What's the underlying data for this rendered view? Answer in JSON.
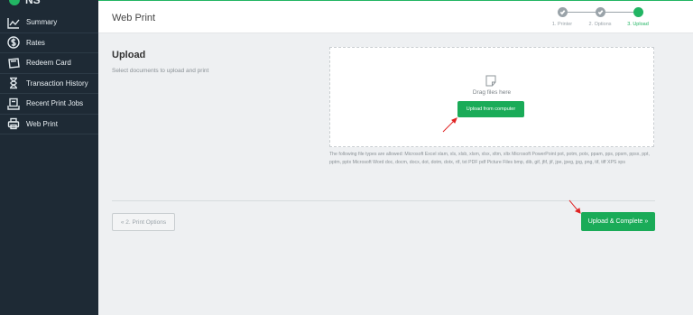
{
  "app": {
    "logo_text": "NS",
    "brand_color": "#22b563"
  },
  "sidebar": {
    "items": [
      {
        "label": "Summary",
        "icon": "chart-line-icon"
      },
      {
        "label": "Rates",
        "icon": "dollar-circle-icon"
      },
      {
        "label": "Redeem Card",
        "icon": "card-icon"
      },
      {
        "label": "Transaction History",
        "icon": "hourglass-icon"
      },
      {
        "label": "Recent Print Jobs",
        "icon": "print-jobs-icon"
      },
      {
        "label": "Web Print",
        "icon": "printer-icon"
      }
    ]
  },
  "header": {
    "title": "Web Print",
    "steps": [
      {
        "label": "1. Printer",
        "state": "done"
      },
      {
        "label": "2. Options",
        "state": "done"
      },
      {
        "label": "3. Upload",
        "state": "active"
      }
    ]
  },
  "upload": {
    "title": "Upload",
    "subtitle": "Select documents to upload and print",
    "drag_text": "Drag files here",
    "upload_button": "Upload from computer",
    "filetypes": "The following file types are allowed: Microsoft Excel xlam, xls, xlsb, xlsm, xlsx, xltm, xltx Microsoft PowerPoint pot, potm, potx, ppam, pps, ppsm, ppsx, ppt, pptm, pptx Microsoft Word doc, docm, docx, dot, dotm, dotx, rtf, txt PDF pdf Picture Files bmp, dib, gif, jfif, jif, jpe, jpeg, jpg, png, tif, tiff XPS xps"
  },
  "footer": {
    "back_button": "« 2. Print Options",
    "complete_button": "Upload & Complete »"
  },
  "colors": {
    "sidebar_bg": "#1e2a35",
    "accent": "#22b563",
    "annotation_arrow": "#e02424"
  }
}
